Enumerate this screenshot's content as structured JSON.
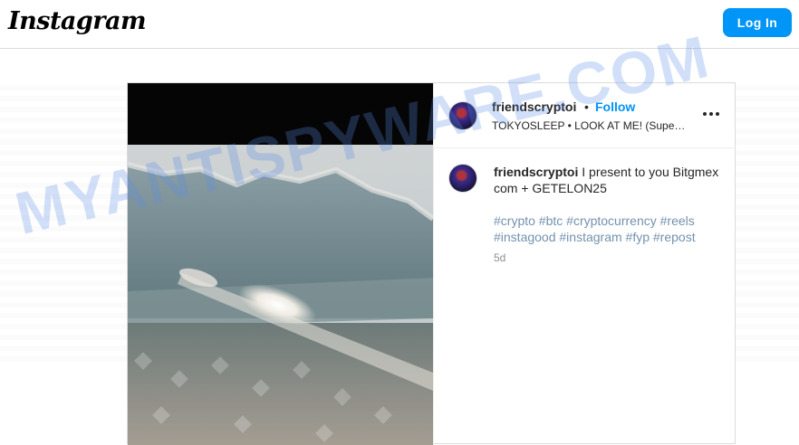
{
  "header": {
    "logo_text": "Instagram",
    "login_label": "Log In"
  },
  "post": {
    "username": "friendscryptoi",
    "separator": "•",
    "follow_label": "Follow",
    "audio": "TOKYOSLEEP • LOOK AT ME! (Supe…",
    "more_glyph": "•••",
    "caption_user": "friendscryptoi",
    "caption_text": " I present to you Bitgmex com + GETELON25",
    "hashtags": "#crypto #btc #cryptocurrency #reels #instagood #instagram #fyp #repost",
    "time_ago": "5d"
  },
  "watermark": "MYANTISPYWARE.COM",
  "colors": {
    "accent": "#0095f6",
    "border": "#dbdbdb",
    "watermark": "#5a8ce6"
  }
}
